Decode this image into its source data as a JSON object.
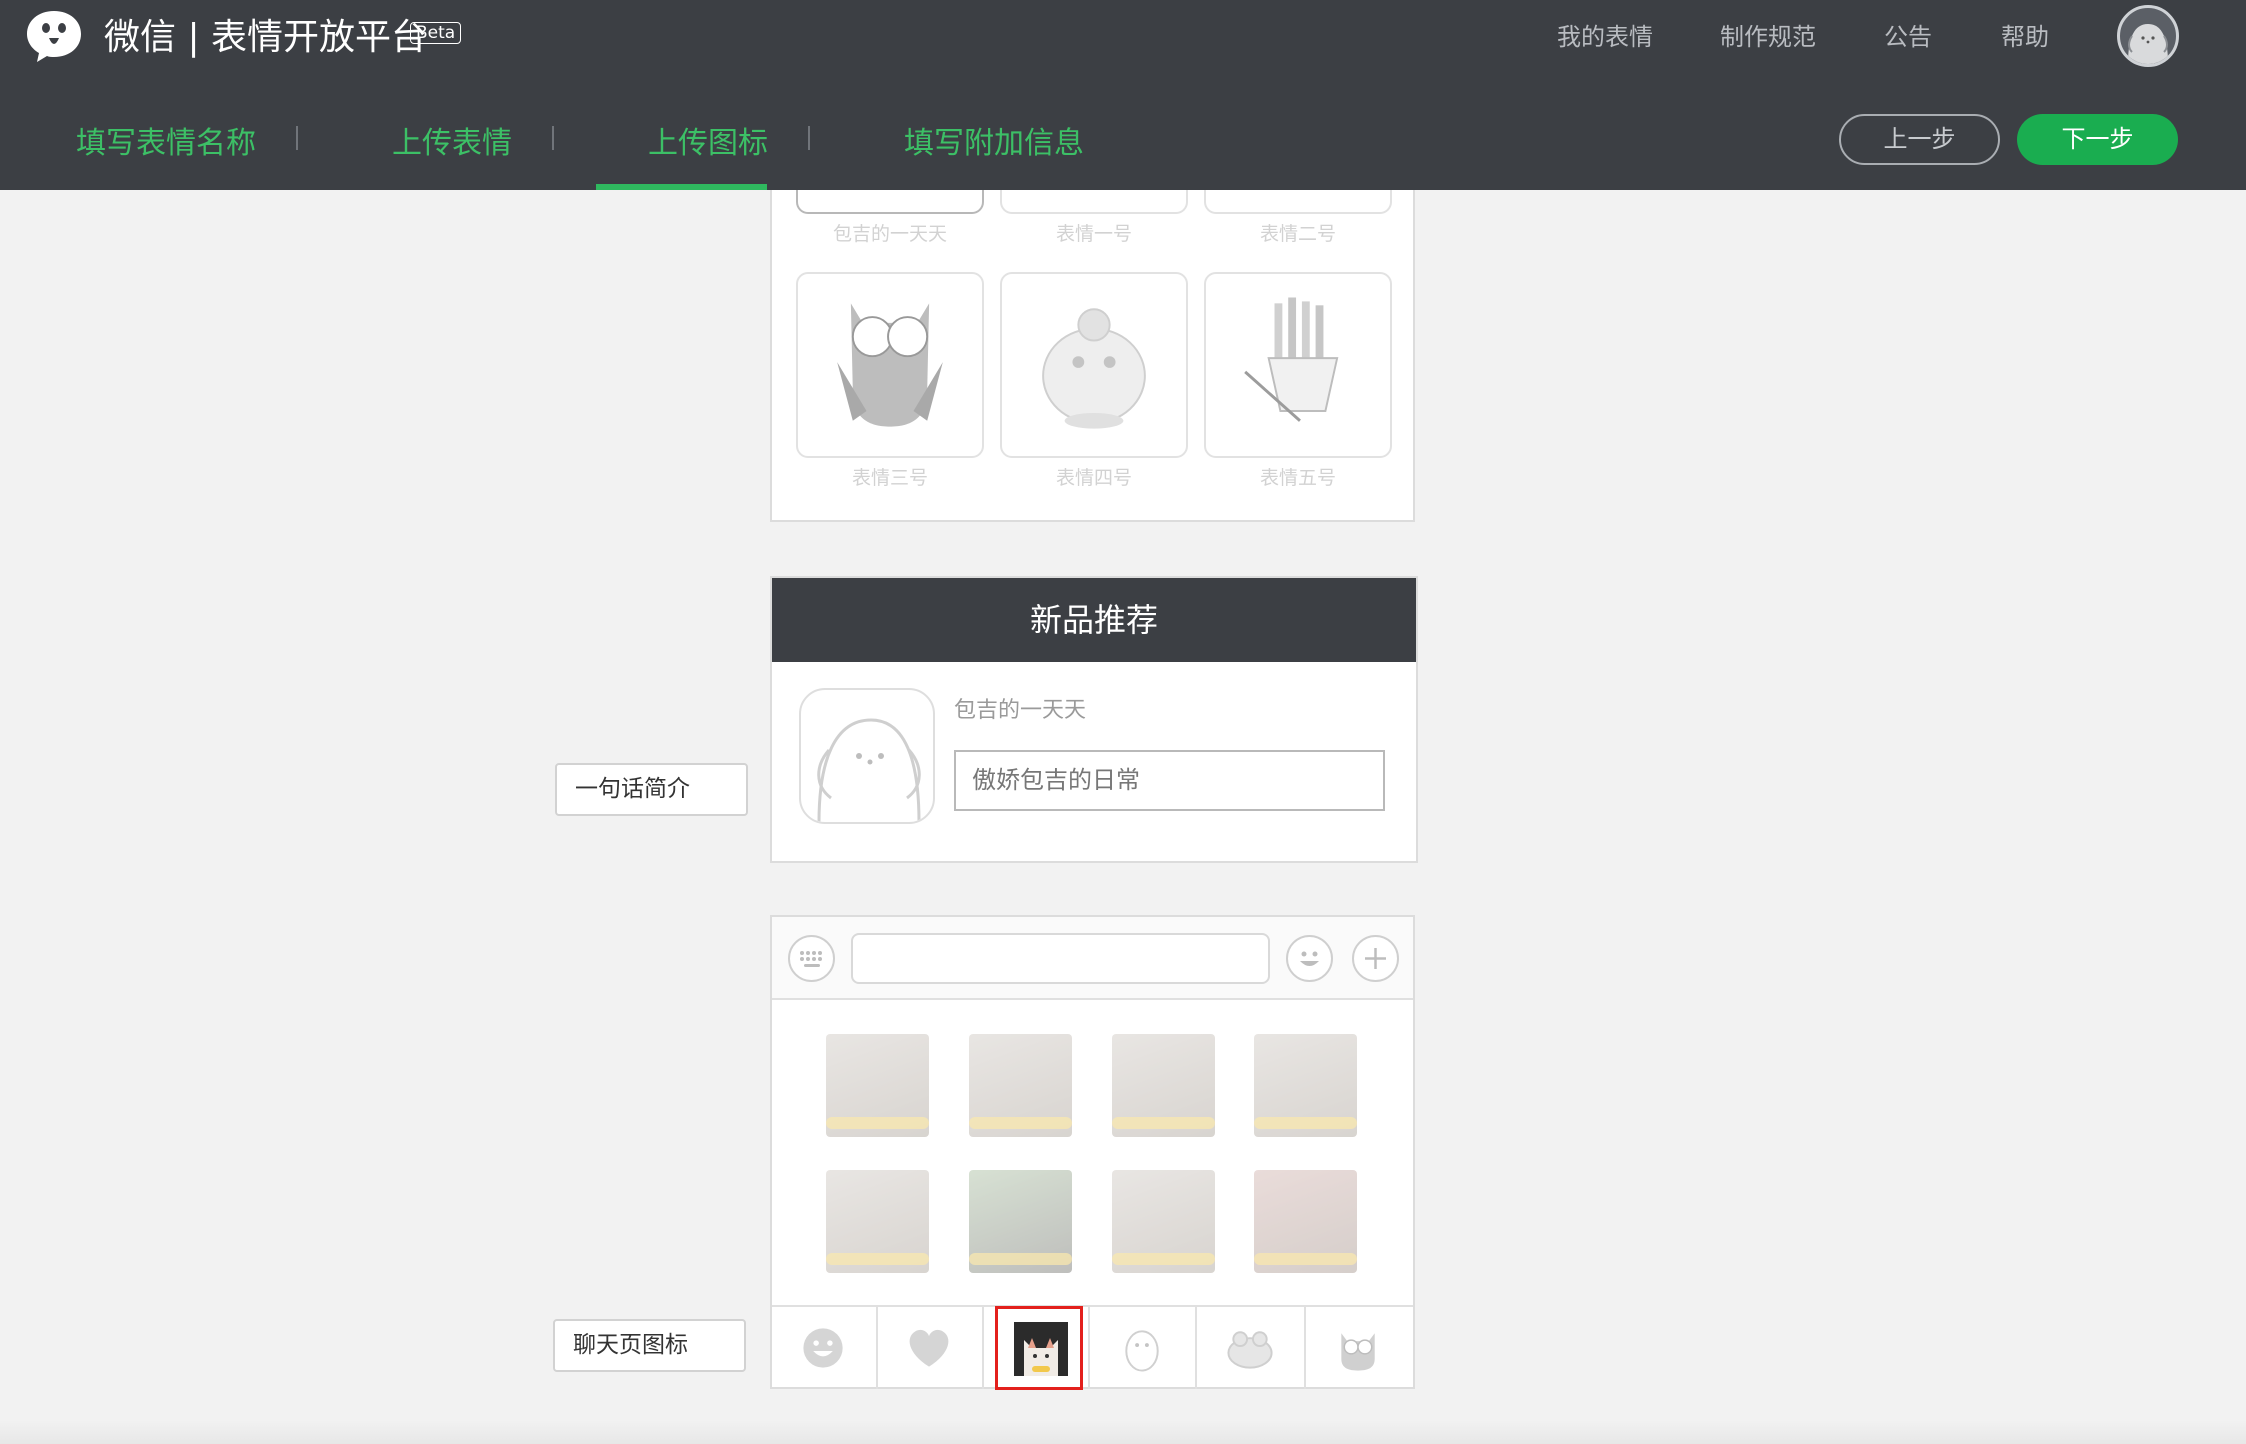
{
  "header": {
    "brand": "微信 | 表情开放平台",
    "beta": "Beta",
    "nav": [
      "我的表情",
      "制作规范",
      "公告",
      "帮助"
    ]
  },
  "steps": [
    {
      "label": "填写表情名称",
      "state": "done"
    },
    {
      "label": "上传表情",
      "state": "done"
    },
    {
      "label": "上传图标",
      "state": "active"
    },
    {
      "label": "填写附加信息",
      "state": "todo"
    }
  ],
  "actions": {
    "prev": "上一步",
    "next": "下一步"
  },
  "sticker_panel": {
    "labels_top": [
      "包吉的一天天",
      "表情一号",
      "表情二号"
    ],
    "labels_bottom": [
      "表情三号",
      "表情四号",
      "表情五号"
    ]
  },
  "recommend": {
    "title": "新品推荐",
    "name": "包吉的一天天",
    "intro": "傲娇包吉的日常"
  },
  "side_labels": {
    "intro": "一句话简介",
    "chat_icon": "聊天页图标"
  },
  "colors": {
    "header_bg": "#3c3f44",
    "accent_green": "#1aad50",
    "step_green": "#3cc066",
    "highlight_red": "#e3201c"
  }
}
